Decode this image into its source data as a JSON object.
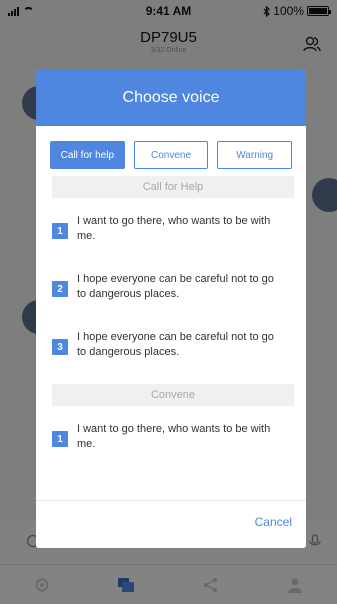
{
  "status_bar": {
    "time": "9:41 AM",
    "battery": "100%",
    "icons": [
      "signal-icon",
      "wifi-icon",
      "bluetooth-icon",
      "battery-icon"
    ]
  },
  "header": {
    "title": "DP79U5",
    "subtitle": "3/32 Online",
    "right_icon": "group-icon"
  },
  "dialog": {
    "title": "Choose voice",
    "tabs": [
      {
        "label": "Call for help",
        "active": true
      },
      {
        "label": "Convene",
        "active": false
      },
      {
        "label": "Warning",
        "active": false
      }
    ],
    "sections": [
      {
        "header": "Call for Help",
        "items": [
          {
            "number": "1",
            "text": "I want to go there, who wants to be with me."
          },
          {
            "number": "2",
            "text": "I hope everyone can be careful not to go to dangerous places."
          },
          {
            "number": "3",
            "text": "I hope everyone can be careful not to go to dangerous places."
          }
        ]
      },
      {
        "header": "Convene",
        "items": [
          {
            "number": "1",
            "text": "I want to go there, who wants to be with me."
          }
        ]
      }
    ],
    "cancel_label": "Cancel"
  },
  "tabbar": {
    "icons": [
      "location-icon",
      "chat-icon",
      "share-icon",
      "profile-icon"
    ]
  },
  "colors": {
    "accent": "#4f86e0",
    "overlay": "rgba(0,0,0,0.47)",
    "section_bg": "#f0f0f0"
  }
}
